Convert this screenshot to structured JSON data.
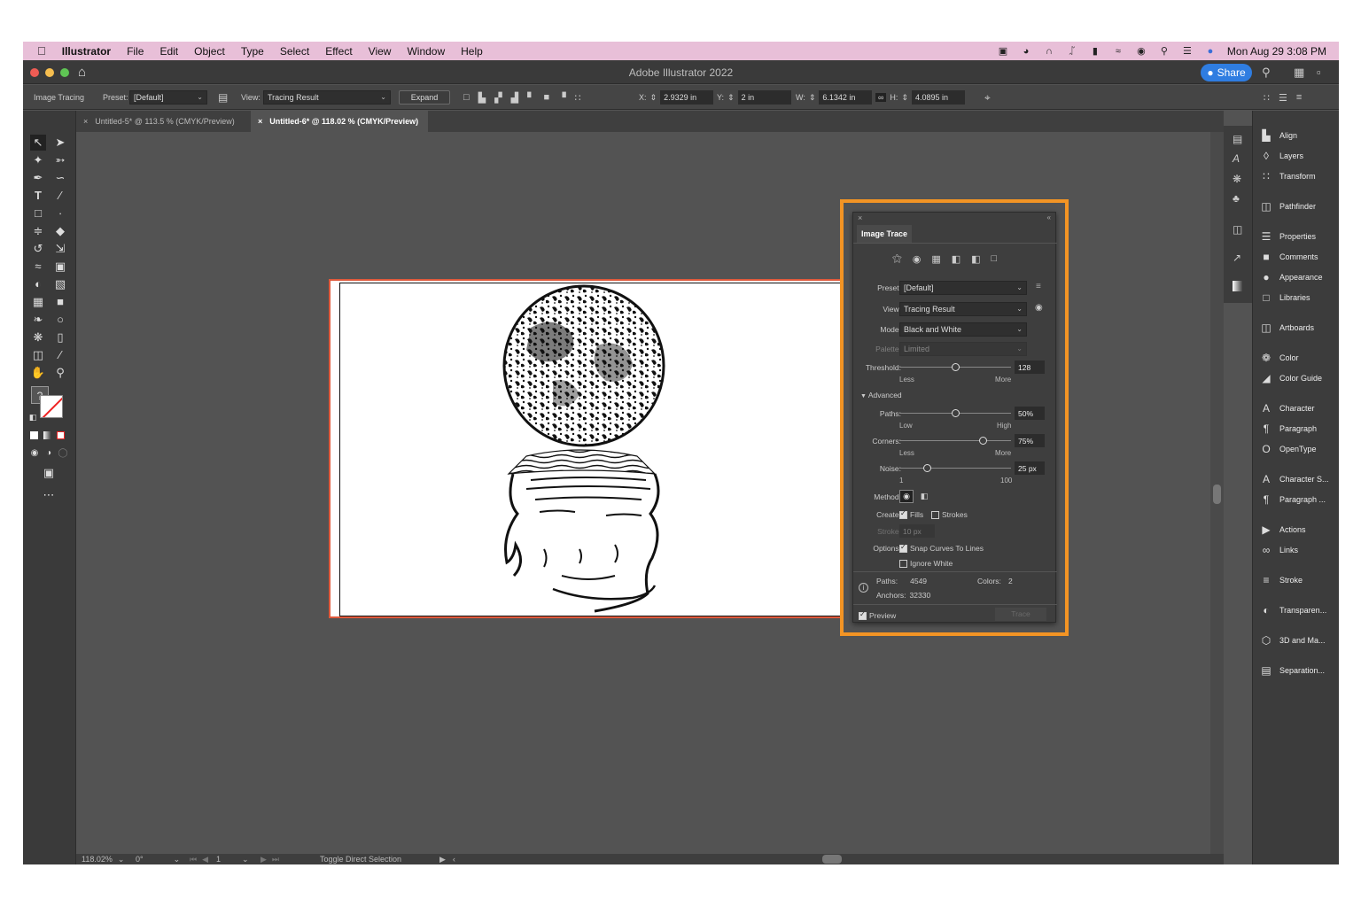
{
  "menubar": {
    "app": "Illustrator",
    "items": [
      "File",
      "Edit",
      "Object",
      "Type",
      "Select",
      "Effect",
      "View",
      "Window",
      "Help"
    ],
    "datetime": "Mon Aug 29  3:08 PM"
  },
  "window": {
    "title": "Adobe Illustrator 2022",
    "share_label": "Share"
  },
  "control": {
    "mode": "Image Tracing",
    "preset_label": "Preset:",
    "preset_value": "[Default]",
    "view_label": "View:",
    "view_value": "Tracing Result",
    "expand_label": "Expand",
    "x_label": "X:",
    "x_value": "2.9329 in",
    "y_label": "Y:",
    "y_value": "2 in",
    "w_label": "W:",
    "w_value": "6.1342 in",
    "h_label": "H:",
    "h_value": "4.0895 in"
  },
  "tabs": [
    {
      "label": "Untitled-5* @ 113.5 % (CMYK/Preview)"
    },
    {
      "label": "Untitled-6* @ 118.02 % (CMYK/Preview)"
    }
  ],
  "status": {
    "zoom": "118.02%",
    "rotate": "0°",
    "artboard": "1",
    "tool": "Toggle Direct Selection"
  },
  "image_trace": {
    "tab": "Image Trace",
    "preset_label": "Preset:",
    "preset_value": "[Default]",
    "view_label": "View:",
    "view_value": "Tracing Result",
    "mode_label": "Mode:",
    "mode_value": "Black and White",
    "palette_label": "Palette:",
    "palette_value": "Limited",
    "threshold_label": "Threshold:",
    "threshold_value": "128",
    "threshold_pos": 0.5,
    "less": "Less",
    "more": "More",
    "advanced": "Advanced",
    "paths_label": "Paths:",
    "paths_value": "50%",
    "paths_pos": 0.5,
    "low": "Low",
    "high": "High",
    "corners_label": "Corners:",
    "corners_value": "75%",
    "corners_pos": 0.75,
    "noise_label": "Noise:",
    "noise_value": "25 px",
    "noise_pos": 0.25,
    "noise_min": "1",
    "noise_max": "100",
    "method_label": "Method:",
    "create_label": "Create:",
    "fills": "Fills",
    "strokes": "Strokes",
    "stroke_label": "Stroke:",
    "stroke_value": "10 px",
    "options_label": "Options:",
    "snap": "Snap Curves To Lines",
    "ignore_white": "Ignore White",
    "stat_paths_label": "Paths:",
    "stat_paths": "4549",
    "stat_colors_label": "Colors:",
    "stat_colors": "2",
    "stat_anchors_label": "Anchors:",
    "stat_anchors": "32330",
    "preview": "Preview",
    "trace": "Trace"
  },
  "dock": [
    {
      "label": "Align",
      "icon": "align-icon"
    },
    {
      "label": "Layers",
      "icon": "layers-icon"
    },
    {
      "label": "Transform",
      "icon": "transform-icon"
    },
    {
      "label": "Pathfinder",
      "icon": "pathfinder-icon"
    },
    {
      "label": "Properties",
      "icon": "properties-icon"
    },
    {
      "label": "Comments",
      "icon": "comments-icon"
    },
    {
      "label": "Appearance",
      "icon": "appearance-icon"
    },
    {
      "label": "Libraries",
      "icon": "libraries-icon"
    },
    {
      "label": "Artboards",
      "icon": "artboards-icon"
    },
    {
      "label": "Color",
      "icon": "color-icon"
    },
    {
      "label": "Color Guide",
      "icon": "color-guide-icon"
    },
    {
      "label": "Character",
      "icon": "character-icon"
    },
    {
      "label": "Paragraph",
      "icon": "paragraph-icon"
    },
    {
      "label": "OpenType",
      "icon": "opentype-icon"
    },
    {
      "label": "Character S...",
      "icon": "character-styles-icon"
    },
    {
      "label": "Paragraph ...",
      "icon": "paragraph-styles-icon"
    },
    {
      "label": "Actions",
      "icon": "actions-icon"
    },
    {
      "label": "Links",
      "icon": "links-icon"
    },
    {
      "label": "Stroke",
      "icon": "stroke-icon"
    },
    {
      "label": "Transparen...",
      "icon": "transparency-icon"
    },
    {
      "label": "3D and Ma...",
      "icon": "3d-materials-icon"
    },
    {
      "label": "Separation...",
      "icon": "separations-icon"
    }
  ]
}
